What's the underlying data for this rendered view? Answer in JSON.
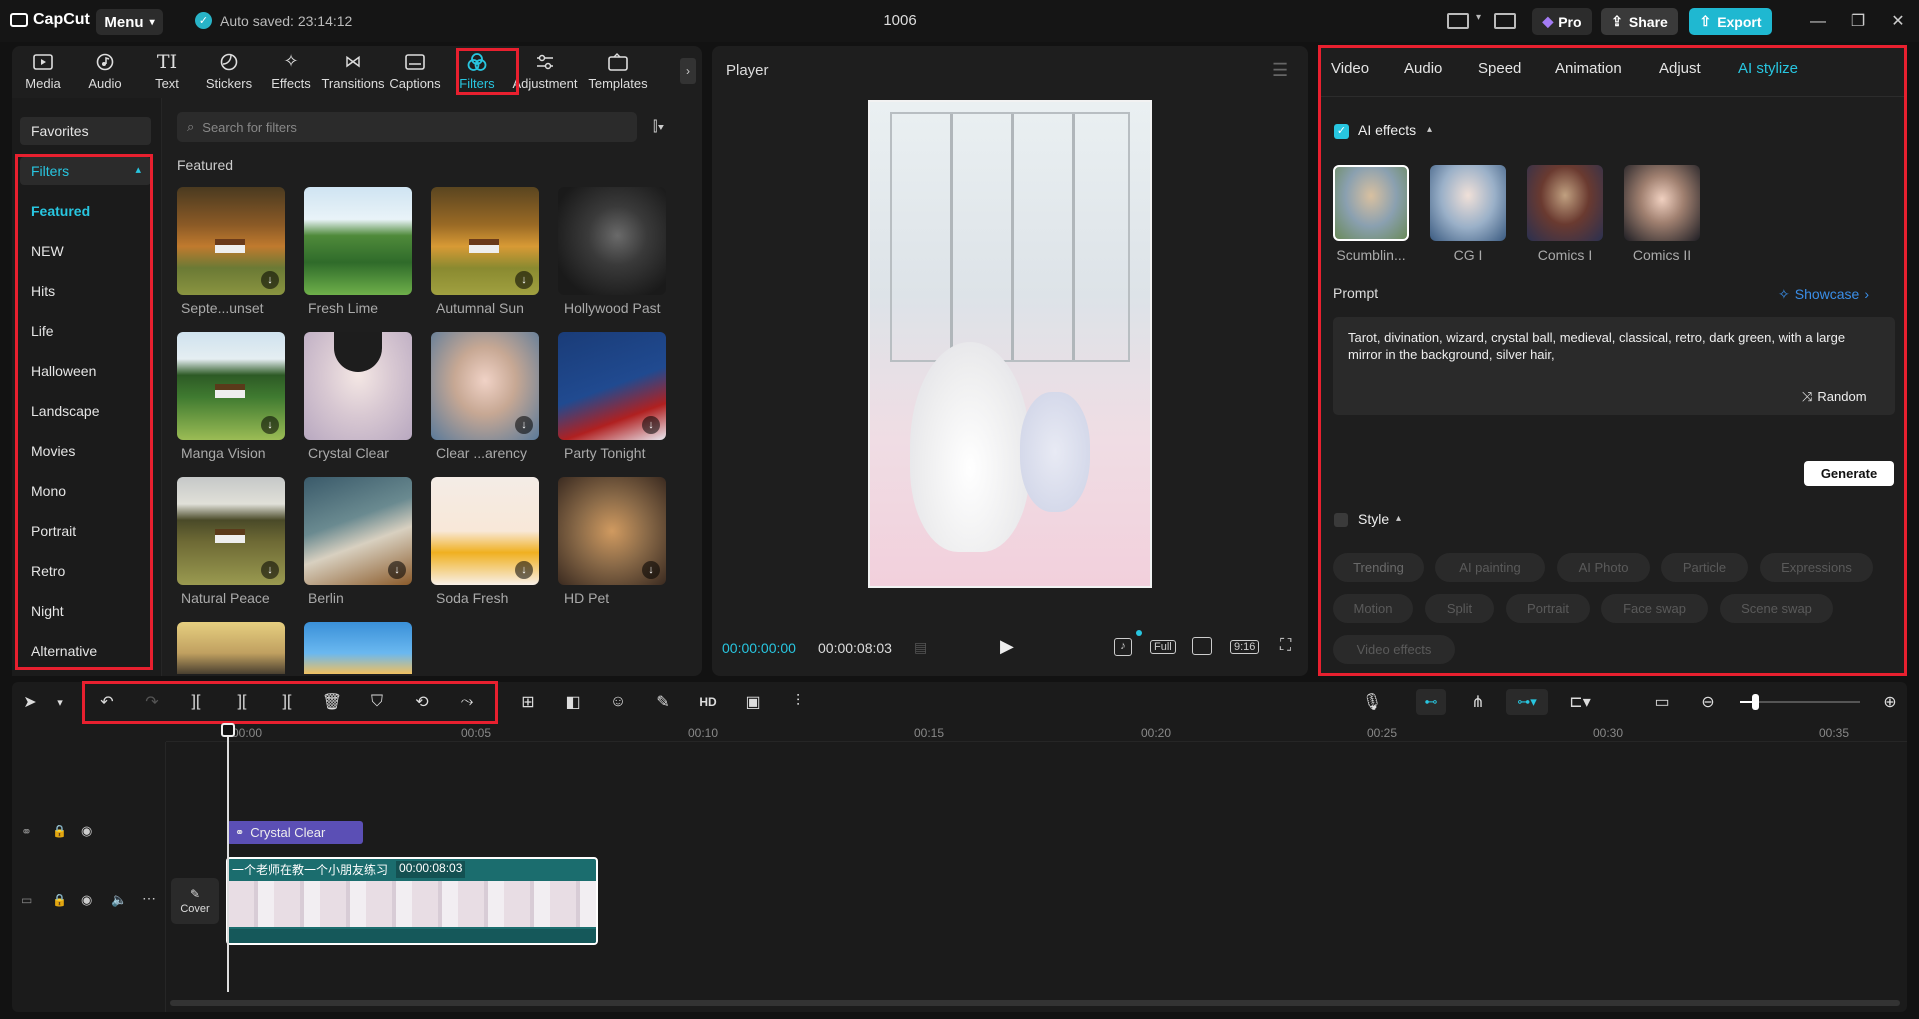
{
  "app": {
    "name": "CapCut",
    "menu_label": "Menu",
    "autosave": "Auto saved: 23:14:12",
    "project_title": "1006"
  },
  "topbar": {
    "pro_label": "Pro",
    "share_label": "Share",
    "export_label": "Export"
  },
  "toolbar": [
    {
      "label": "Media",
      "icon": "media-icon"
    },
    {
      "label": "Audio",
      "icon": "audio-icon"
    },
    {
      "label": "Text",
      "icon": "text-icon"
    },
    {
      "label": "Stickers",
      "icon": "stickers-icon"
    },
    {
      "label": "Effects",
      "icon": "effects-icon"
    },
    {
      "label": "Transitions",
      "icon": "transitions-icon"
    },
    {
      "label": "Captions",
      "icon": "captions-icon"
    },
    {
      "label": "Filters",
      "icon": "filters-icon",
      "active": true
    },
    {
      "label": "Adjustment",
      "icon": "adjustment-icon"
    },
    {
      "label": "Templates",
      "icon": "templates-icon"
    }
  ],
  "sidebar": {
    "favorites": "Favorites",
    "filters_header": "Filters",
    "items": [
      "Featured",
      "NEW",
      "Hits",
      "Life",
      "Halloween",
      "Landscape",
      "Movies",
      "Mono",
      "Portrait",
      "Retro",
      "Night",
      "Alternative"
    ]
  },
  "search": {
    "placeholder": "Search for filters"
  },
  "featured_label": "Featured",
  "filters": [
    {
      "name": "Septe...unset"
    },
    {
      "name": "Fresh Lime"
    },
    {
      "name": "Autumnal Sun"
    },
    {
      "name": "Hollywood Past"
    },
    {
      "name": "Manga Vision"
    },
    {
      "name": "Crystal Clear"
    },
    {
      "name": "Clear ...arency"
    },
    {
      "name": "Party Tonight"
    },
    {
      "name": "Natural Peace"
    },
    {
      "name": "Berlin"
    },
    {
      "name": "Soda Fresh"
    },
    {
      "name": "HD Pet"
    }
  ],
  "player": {
    "title": "Player",
    "current_time": "00:00:00:00",
    "total_time": "00:00:08:03",
    "full_label": "Full",
    "ratio_label": "9:16"
  },
  "right_panel": {
    "tabs": [
      "Video",
      "Audio",
      "Speed",
      "Animation",
      "Adjust",
      "AI stylize"
    ],
    "active_tab": "AI stylize",
    "ai_effects_label": "AI effects",
    "ai_effects": [
      "Scumblin...",
      "CG I",
      "Comics I",
      "Comics II"
    ],
    "prompt_label": "Prompt",
    "showcase_label": "Showcase",
    "prompt_text": "Tarot, divination, wizard, crystal ball, medieval, classical, retro, dark green, with a large mirror in the background, silver hair,",
    "random_label": "Random",
    "generate_label": "Generate",
    "style_label": "Style",
    "style_chips_row1": [
      "Trending",
      "AI painting",
      "AI Photo",
      "Particle",
      "Expressions"
    ],
    "style_chips_row2": [
      "Motion",
      "Split",
      "Portrait",
      "Face swap",
      "Scene swap"
    ],
    "style_chips_row3": [
      "Video effects"
    ]
  },
  "timeline": {
    "ruler": [
      "00:00",
      "00:05",
      "00:10",
      "00:15",
      "00:20",
      "00:25",
      "00:30",
      "00:35"
    ],
    "filter_clip_label": "Crystal Clear",
    "video_clip_title": "一个老师在教一个小朋友练习",
    "video_clip_duration": "00:00:08:03",
    "cover_label": "Cover"
  },
  "colors": {
    "accent": "#28c6e0",
    "highlight": "#e8202f",
    "export": "#1fb8d1",
    "filter_clip": "#5b4fb5",
    "video_clip": "#1b6d6e"
  }
}
